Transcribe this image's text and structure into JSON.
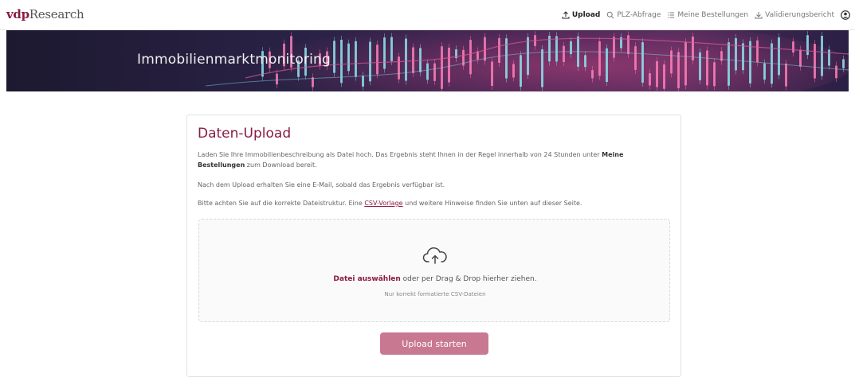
{
  "header": {
    "logo_brand": "vdp",
    "logo_rest": "Research",
    "nav": [
      {
        "label": "Upload",
        "icon": "upload-icon",
        "active": true
      },
      {
        "label": "PLZ-Abfrage",
        "icon": "search-icon",
        "active": false
      },
      {
        "label": "Meine Bestellungen",
        "icon": "list-icon",
        "active": false
      },
      {
        "label": "Validierungsbericht",
        "icon": "download-icon",
        "active": false
      }
    ],
    "user_icon": "user-icon"
  },
  "hero": {
    "title": "Immobilienmarktmonitoring"
  },
  "card": {
    "title": "Daten-Upload",
    "p1_before": "Laden Sie Ihre Immobilienbeschreibung als Datei hoch. Das Ergebnis steht Ihnen in der Regel innerhalb von 24 Stunden unter ",
    "p1_bold": "Meine Bestellungen",
    "p1_after": " zum Download bereit.",
    "p2": "Nach dem Upload erhalten Sie eine E-Mail, sobald das Ergebnis verfügbar ist.",
    "p3_before": "Bitte achten Sie auf die korrekte Dateistruktur. Eine ",
    "p3_link": "CSV-Vorlage",
    "p3_after": " und weitere Hinweise finden Sie unten auf dieser Seite."
  },
  "dropzone": {
    "icon": "cloud-upload-icon",
    "choose_label": "Datei auswählen",
    "text_after": " oder per Drag & Drop hierher ziehen.",
    "hint": "Nur korrekt formatierte CSV-Dateien"
  },
  "upload_button_label": "Upload starten",
  "colors": {
    "brand": "#8a1a44",
    "button": "#c97891",
    "hero_bg": "#1b1731"
  }
}
